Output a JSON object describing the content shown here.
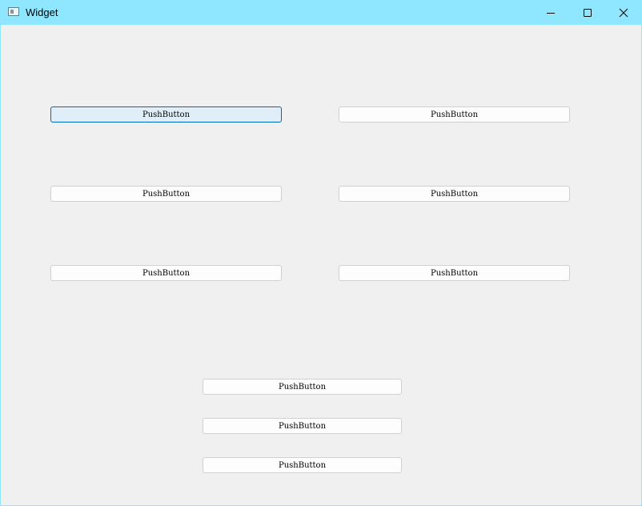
{
  "window": {
    "title": "Widget",
    "icon": "app-window-icon",
    "controls": {
      "minimize_icon": "minimize-icon",
      "maximize_icon": "maximize-icon",
      "close_icon": "close-icon"
    },
    "titlebar_color": "#8ee6ff",
    "background_color": "#f0f0f0"
  },
  "buttons": [
    {
      "label": "PushButton",
      "focused": true
    },
    {
      "label": "PushButton",
      "focused": false
    },
    {
      "label": "PushButton",
      "focused": false
    },
    {
      "label": "PushButton",
      "focused": false
    },
    {
      "label": "PushButton",
      "focused": false
    },
    {
      "label": "PushButton",
      "focused": false
    },
    {
      "label": "PushButton",
      "focused": false
    },
    {
      "label": "PushButton",
      "focused": false
    },
    {
      "label": "PushButton",
      "focused": false
    }
  ],
  "colors": {
    "focus_border": "#0067c0",
    "focus_fill": "#e0eef9"
  }
}
